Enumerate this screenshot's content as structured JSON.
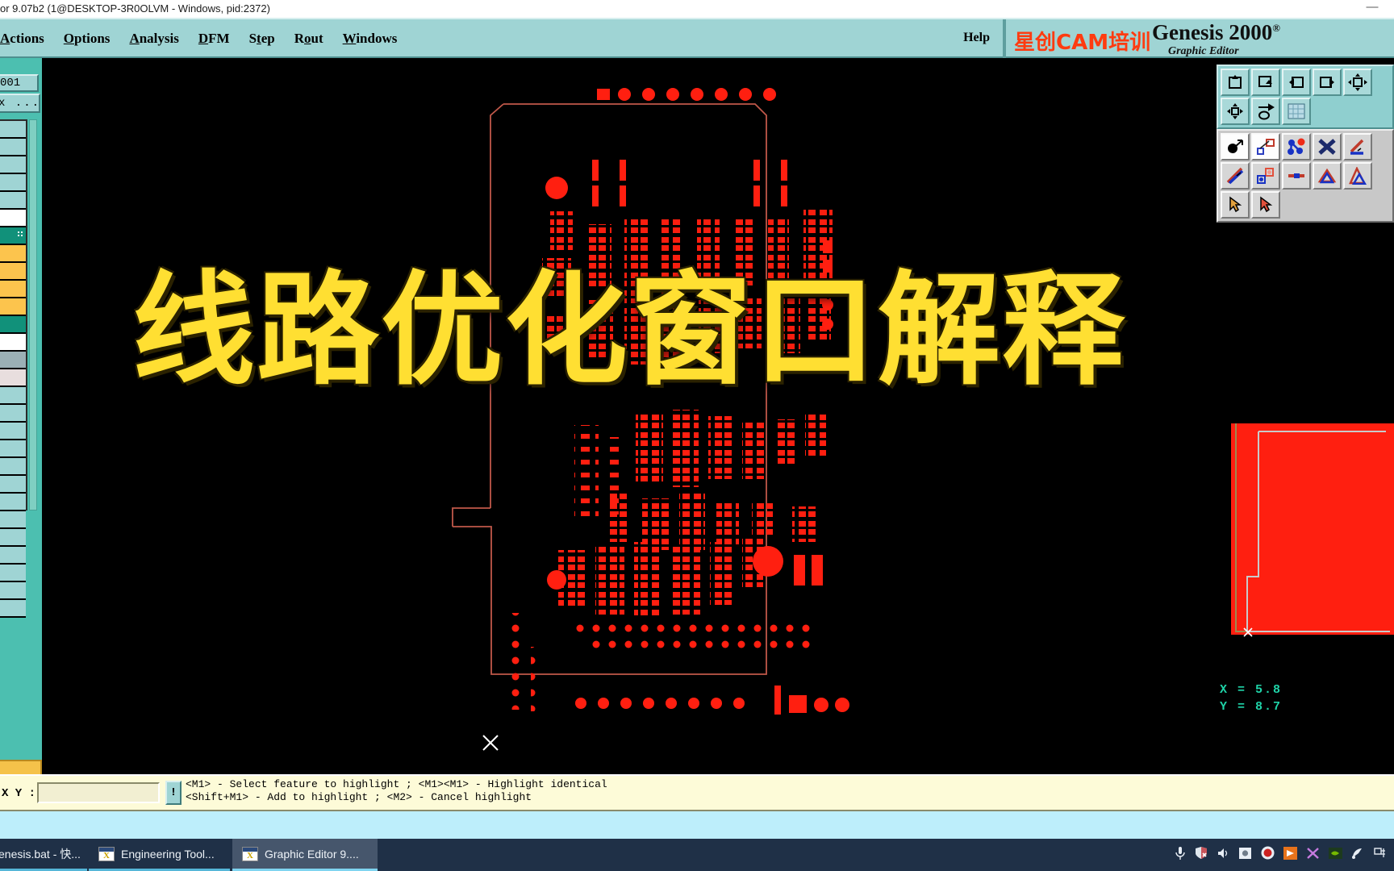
{
  "os_window": {
    "title": "or 9.07b2 (1@DESKTOP-3R0OLVM - Windows, pid:2372)",
    "minimize_glyph": "—"
  },
  "menubar": {
    "items": [
      {
        "label": "Actions",
        "mnemonic": "A"
      },
      {
        "label": "Options",
        "mnemonic": "O"
      },
      {
        "label": "Analysis",
        "mnemonic": "A"
      },
      {
        "label": "DFM",
        "mnemonic": "D"
      },
      {
        "label": "Step",
        "mnemonic": "S"
      },
      {
        "label": "Rout",
        "mnemonic": "R"
      },
      {
        "label": "Windows",
        "mnemonic": "W"
      }
    ],
    "help_label": "Help"
  },
  "brand": {
    "watermark_cn": "星创CAM培训",
    "product": "Genesis 2000",
    "product_sup": "®",
    "subtitle": "Graphic Editor",
    "watermark_color": "#ff3b10"
  },
  "left_panel": {
    "step_name": "001",
    "menu_dots": "x  ...",
    "layers": [
      {
        "color": "#9fd4d4",
        "selected": false
      },
      {
        "color": "#9fd4d4",
        "selected": false
      },
      {
        "color": "#9fd4d4",
        "selected": false
      },
      {
        "color": "#9fd4d4",
        "selected": false
      },
      {
        "color": "#9fd4d4",
        "selected": false
      },
      {
        "color": "#ffffff",
        "selected": false
      },
      {
        "color": "#11917a",
        "selected": true
      },
      {
        "color": "#fcc44d",
        "selected": false
      },
      {
        "color": "#fcc44d",
        "selected": false
      },
      {
        "color": "#fcc44d",
        "selected": false
      },
      {
        "color": "#fcc44d",
        "selected": false
      },
      {
        "color": "#11917a",
        "selected": false
      },
      {
        "color": "#ffffff",
        "selected": false
      },
      {
        "color": "#9bb0b5",
        "selected": false
      },
      {
        "color": "#e8dede",
        "selected": false
      },
      {
        "color": "#9fd4d4",
        "selected": false
      },
      {
        "color": "#9fd4d4",
        "selected": false
      },
      {
        "color": "#9fd4d4",
        "selected": false
      },
      {
        "color": "#9fd4d4",
        "selected": false
      },
      {
        "color": "#9fd4d4",
        "selected": false
      },
      {
        "color": "#9fd4d4",
        "selected": false
      },
      {
        "color": "#9fd4d4",
        "selected": false
      },
      {
        "color": "#9fd4d4",
        "selected": false
      },
      {
        "color": "#9fd4d4",
        "selected": false
      },
      {
        "color": "#9fd4d4",
        "selected": false
      },
      {
        "color": "#9fd4d4",
        "selected": false
      },
      {
        "color": "#9fd4d4",
        "selected": false
      },
      {
        "color": "#9fd4d4",
        "selected": false
      }
    ]
  },
  "canvas": {
    "overlay_title": "线路优化窗口解释",
    "overlay_color": "#ffdf32",
    "background_color": "#000000",
    "trace_color": "#ff1f10",
    "outline_color": "#c0584a",
    "cursor_marker": "x-crosshair"
  },
  "right_toolbar": {
    "rows_top": [
      [
        "zoom-home-icon",
        "zoom-in-window-icon"
      ],
      [
        "pan-left-icon",
        "pan-right-icon"
      ],
      [
        "zoom-fit-vertical-icon",
        "zoom-fit-all-icon"
      ],
      [
        "wrench-palette-icon",
        "grid-icon"
      ]
    ],
    "rows_bottom": [
      [
        "select-feature-icon",
        "measure-icon"
      ],
      [
        "net-select-icon",
        "delete-cross-icon"
      ],
      [
        "line-select-icon",
        "line-add-icon"
      ],
      [
        "pad-copy-icon",
        "line-segment-icon"
      ],
      [
        "surface-select-icon",
        "surface-add-icon"
      ],
      [
        "cursor-arrow-icon",
        "cursor-arrow-alt-icon"
      ]
    ]
  },
  "coordinates": {
    "x_line": "X = 5.8",
    "y_line": "Y = 8.7",
    "color": "#1fd4a8"
  },
  "statusbar": {
    "xy_label": "X Y :",
    "xy_value": "",
    "xy_placeholder": "",
    "bang_label": "!",
    "hint_line1": "<M1> - Select feature to highlight ; <M1><M1> - Highlight identical",
    "hint_line2": "<Shift+M1> - Add to highlight ; <M2> - Cancel highlight"
  },
  "taskbar": {
    "items": [
      {
        "label": "enesis.bat - 快...",
        "icon": "window-icon",
        "active": false
      },
      {
        "label": "Engineering Tool...",
        "icon": "window-icon",
        "active": false
      },
      {
        "label": "Graphic Editor 9....",
        "icon": "window-icon",
        "active": true
      }
    ],
    "tray_icons": [
      "microphone-icon",
      "security-shield-icon",
      "speaker-icon",
      "display-icon",
      "record-icon",
      "flag-icon",
      "x-close-icon",
      "nvidia-icon",
      "satellite-icon",
      "network-icon"
    ]
  }
}
